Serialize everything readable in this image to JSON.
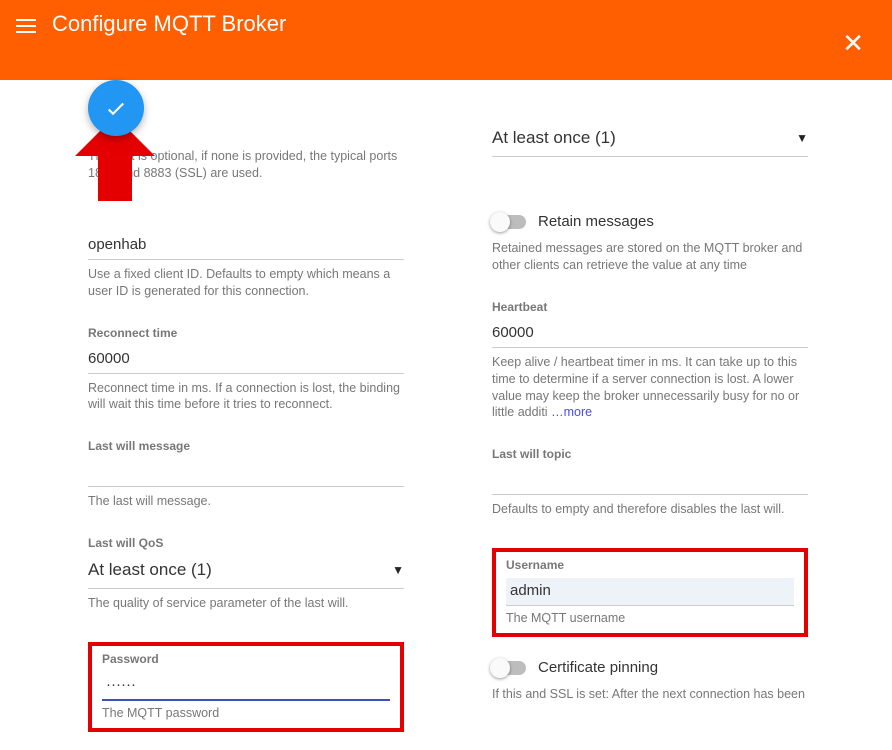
{
  "header": {
    "title": "Configure MQTT Broker"
  },
  "left": {
    "port_help": "The port is optional, if none is provided, the typical ports 1883 and 8883 (SSL) are used.",
    "client_id": {
      "value": "openhab",
      "help": "Use a fixed client ID. Defaults to empty which means a user ID is generated for this connection."
    },
    "reconnect": {
      "label": "Reconnect time",
      "value": "60000",
      "help": "Reconnect time in ms. If a connection is lost, the binding will wait this time before it tries to reconnect."
    },
    "lastwill_msg": {
      "label": "Last will message",
      "value": "",
      "help": "The last will message."
    },
    "lastwill_qos": {
      "label": "Last will QoS",
      "value": "At least once (1)",
      "help": "The quality of service parameter of the last will."
    },
    "password": {
      "label": "Password",
      "value": "······",
      "help": "The MQTT password"
    }
  },
  "right": {
    "qos_top": {
      "value": "At least once (1)"
    },
    "retain": {
      "label": "Retain messages",
      "help": "Retained messages are stored on the MQTT broker and other clients can retrieve the value at any time"
    },
    "heartbeat": {
      "label": "Heartbeat",
      "value": "60000",
      "help": "Keep alive / heartbeat timer in ms. It can take up to this time to determine if a server connection is lost. A lower value may keep the broker unnecessarily busy for no or little additi",
      "more": "…more"
    },
    "lastwill_topic": {
      "label": "Last will topic",
      "value": "",
      "help": "Defaults to empty and therefore disables the last will."
    },
    "username": {
      "label": "Username",
      "value": "admin",
      "help": "The MQTT username"
    },
    "cert_pin": {
      "label": "Certificate pinning",
      "help": "If this and SSL is set: After the next connection has been"
    }
  }
}
